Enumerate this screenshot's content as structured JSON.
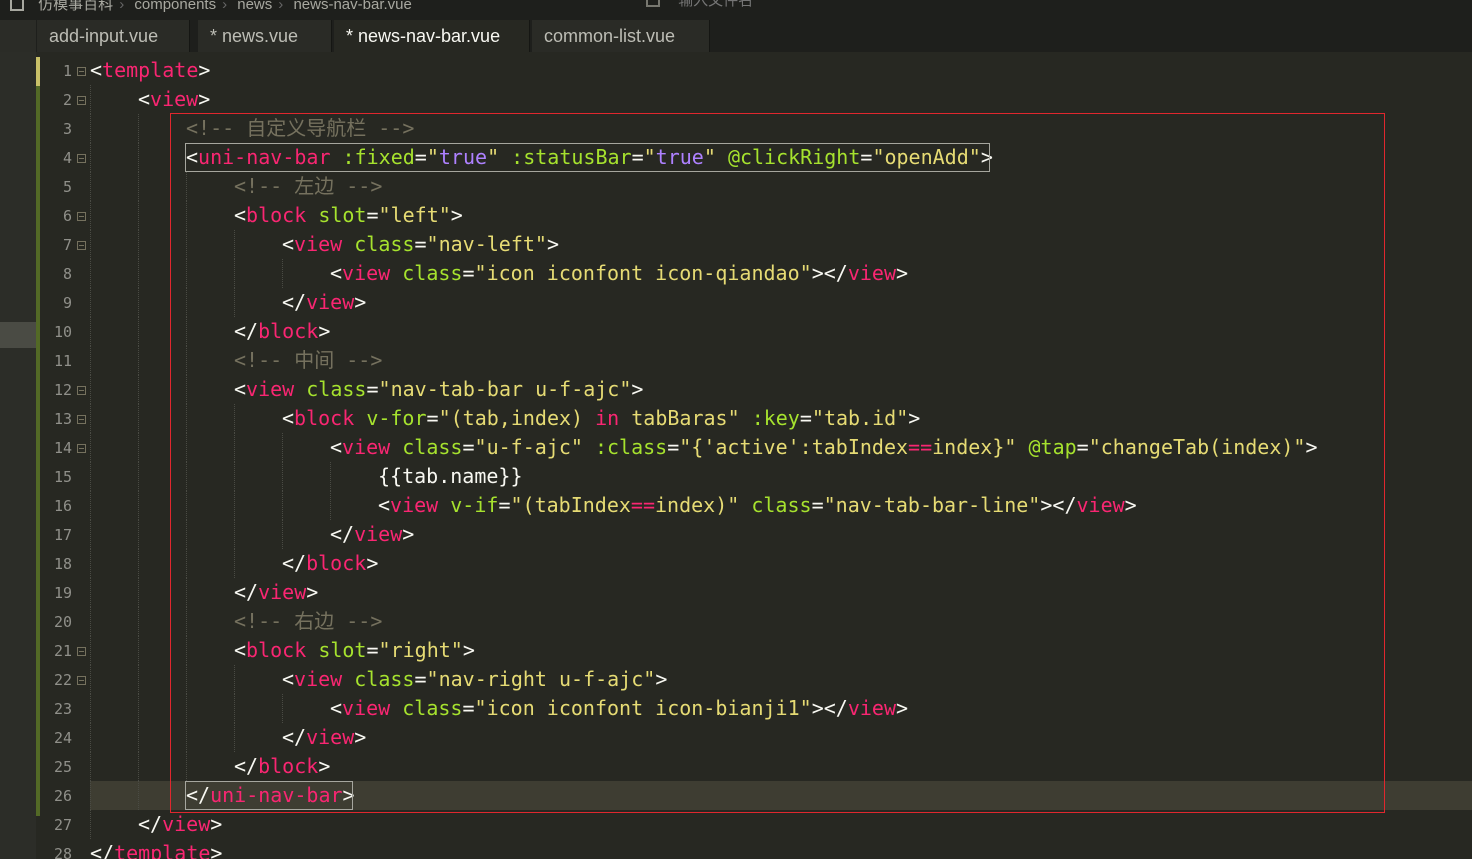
{
  "breadcrumb": {
    "project": "仿模事百科",
    "folder1": "components",
    "folder2": "news",
    "file": "news-nav-bar.vue"
  },
  "file_search": {
    "placeholder": "输入文件名"
  },
  "tabs": [
    {
      "label": "add-input.vue",
      "active": false
    },
    {
      "label": "* news.vue",
      "active": false
    },
    {
      "label": "* news-nav-bar.vue",
      "active": true
    },
    {
      "label": "common-list.vue",
      "active": false
    }
  ],
  "line_numbers": [
    "1",
    "2",
    "3",
    "4",
    "5",
    "6",
    "7",
    "8",
    "9",
    "10",
    "11",
    "12",
    "13",
    "14",
    "15",
    "16",
    "17",
    "18",
    "19",
    "20",
    "21",
    "22",
    "23",
    "24",
    "25",
    "26",
    "27",
    "28"
  ],
  "code_lines": [
    "<template>",
    "    <view>",
    "        <!-- 自定义导航栏 -->",
    "        <uni-nav-bar :fixed=\"true\" :statusBar=\"true\" @clickRight=\"openAdd\">",
    "            <!-- 左边 -->",
    "            <block slot=\"left\">",
    "                <view class=\"nav-left\">",
    "                    <view class=\"icon iconfont icon-qiandao\"></view>",
    "                </view>",
    "            </block>",
    "            <!-- 中间 -->",
    "            <view class=\"nav-tab-bar u-f-ajc\">",
    "                <block v-for=\"(tab,index) in tabBaras\" :key=\"tab.id\">",
    "                    <view class=\"u-f-ajc\" :class=\"{'active':tabIndex==index}\" @tap=\"changeTab(index)\">",
    "                        {{tab.name}}",
    "                        <view v-if=\"(tabIndex==index)\" class=\"nav-tab-bar-line\"></view>",
    "                    </view>",
    "                </block>",
    "            </view>",
    "            <!-- 右边 -->",
    "            <block slot=\"right\">",
    "                <view class=\"nav-right u-f-ajc\">",
    "                    <view class=\"icon iconfont icon-bianji1\"></view>",
    "                </view>",
    "            </block>",
    "        </uni-nav-bar>",
    "    </view>",
    "</template>"
  ],
  "colors": {
    "background": "#272822",
    "tag": "#f92672",
    "attribute": "#a6e22e",
    "string": "#e6db74",
    "comment": "#75715e",
    "highlight_box": "#e0272e"
  }
}
